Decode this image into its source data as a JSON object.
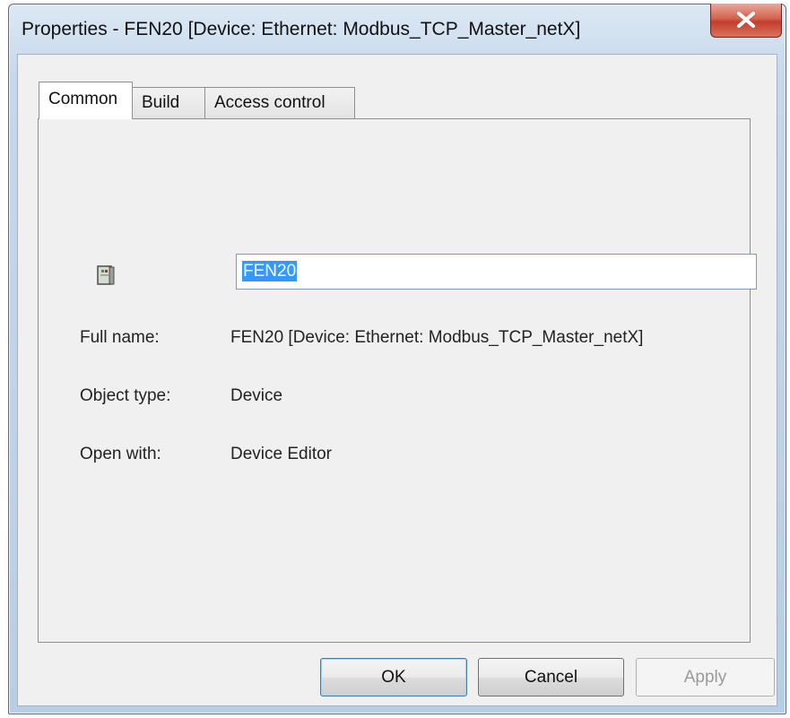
{
  "window": {
    "title": "Properties - FEN20 [Device: Ethernet: Modbus_TCP_Master_netX]",
    "close_icon": "close-icon"
  },
  "tabs": [
    {
      "label": "Common",
      "active": true
    },
    {
      "label": "Build",
      "active": false
    },
    {
      "label": "Access control",
      "active": false
    }
  ],
  "common": {
    "icon": "device-icon",
    "name_value": "FEN20",
    "full_name_label": "Full name:",
    "full_name_value": "FEN20 [Device: Ethernet: Modbus_TCP_Master_netX]",
    "object_type_label": "Object type:",
    "object_type_value": "Device",
    "open_with_label": "Open with:",
    "open_with_value": "Device Editor"
  },
  "buttons": {
    "ok": "OK",
    "cancel": "Cancel",
    "apply": "Apply"
  },
  "colors": {
    "selection": "#3399ff",
    "close_button": "#c13f2c",
    "dialog_background": "#f0f0f0"
  }
}
